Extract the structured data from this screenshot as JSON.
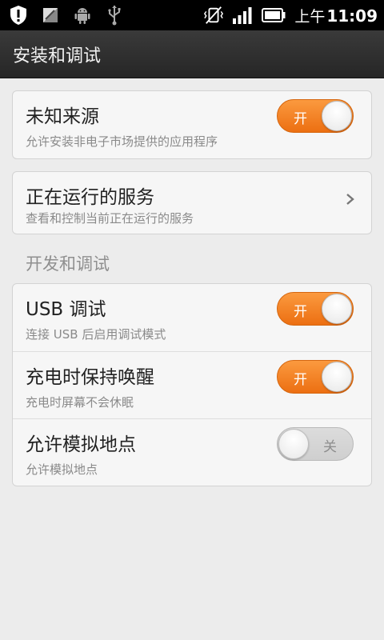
{
  "status_bar": {
    "time_prefix": "上午",
    "time": "11:09",
    "icons_left": [
      "shield-alert-icon",
      "sd-card-icon",
      "android-icon",
      "usb-icon"
    ],
    "icons_right": [
      "vibrate-off-icon",
      "signal-icon",
      "battery-icon"
    ]
  },
  "header": {
    "title": "安装和调试"
  },
  "install": {
    "unknown_sources": {
      "label": "未知来源",
      "summary": "允许安装非电子市场提供的应用程序",
      "toggle_text": "开",
      "enabled": true
    }
  },
  "running": {
    "label": "正在运行的服务",
    "summary": "查看和控制当前正在运行的服务"
  },
  "dev": {
    "section_title": "开发和调试",
    "items": [
      {
        "label": "USB 调试",
        "summary": "连接 USB 后启用调试模式",
        "toggle_text": "开",
        "enabled": true
      },
      {
        "label": "充电时保持唤醒",
        "summary": "充电时屏幕不会休眠",
        "toggle_text": "开",
        "enabled": true
      },
      {
        "label": "允许模拟地点",
        "summary": "允许模拟地点",
        "toggle_text": "关",
        "enabled": false
      }
    ]
  },
  "colors": {
    "accent_orange": "#f0791a",
    "background": "#ececec",
    "titlebar": "#2f2f2f"
  }
}
